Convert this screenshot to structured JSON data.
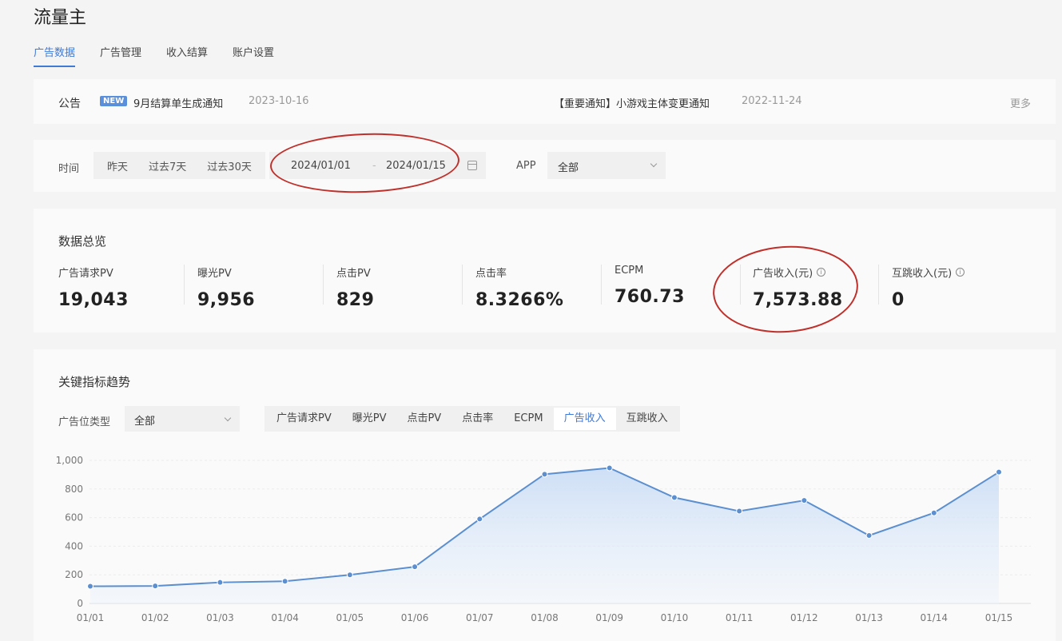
{
  "app": {
    "title": "流量主"
  },
  "nav": {
    "items": [
      "广告数据",
      "广告管理",
      "收入结算",
      "账户设置"
    ]
  },
  "notice": {
    "label": "公告",
    "badge": "NEW",
    "item1": {
      "text": "9月结算单生成通知",
      "date": "2023-10-16"
    },
    "item2": {
      "text": "【重要通知】小游戏主体变更通知",
      "date": "2022-11-24"
    },
    "more": "更多"
  },
  "filter": {
    "time_label": "时间",
    "quick_ranges": [
      "昨天",
      "过去7天",
      "过去30天"
    ],
    "start_date": "2024/01/01",
    "separator": "-",
    "end_date": "2024/01/15",
    "app_label": "APP",
    "app_value": "全部"
  },
  "overview": {
    "title": "数据总览",
    "metrics": [
      {
        "label": "广告请求PV",
        "value": "19,043"
      },
      {
        "label": "曝光PV",
        "value": "9,956"
      },
      {
        "label": "点击PV",
        "value": "829"
      },
      {
        "label": "点击率",
        "value": "8.3266%"
      },
      {
        "label": "ECPM",
        "value": "760.73"
      },
      {
        "label": "广告收入(元)",
        "value": "7,573.88"
      },
      {
        "label": "互跳收入(元)",
        "value": "0"
      }
    ],
    "info_glyph": "i"
  },
  "trend": {
    "title": "关键指标趋势",
    "type_label": "广告位类型",
    "type_value": "全部",
    "tabs": [
      "广告请求PV",
      "曝光PV",
      "点击PV",
      "点击率",
      "ECPM",
      "广告收入",
      "互跳收入"
    ],
    "active_tab": 5
  },
  "colors": {
    "accent": "#3f7ad6",
    "line": "#5b8fcf",
    "annotation": "#c0302b"
  },
  "chart_data": {
    "type": "area",
    "x": [
      "01/01",
      "01/02",
      "01/03",
      "01/04",
      "01/05",
      "01/06",
      "01/07",
      "01/08",
      "01/09",
      "01/10",
      "01/11",
      "01/12",
      "01/13",
      "01/14",
      "01/15"
    ],
    "series": [
      {
        "values": [
          120,
          122,
          147,
          155,
          200,
          256,
          590,
          903,
          947,
          740,
          645,
          720,
          475,
          633,
          918
        ]
      }
    ],
    "yticks": [
      "0",
      "200",
      "400",
      "600",
      "800",
      "1,000"
    ],
    "ylim": [
      0,
      1000
    ],
    "grid": true
  }
}
